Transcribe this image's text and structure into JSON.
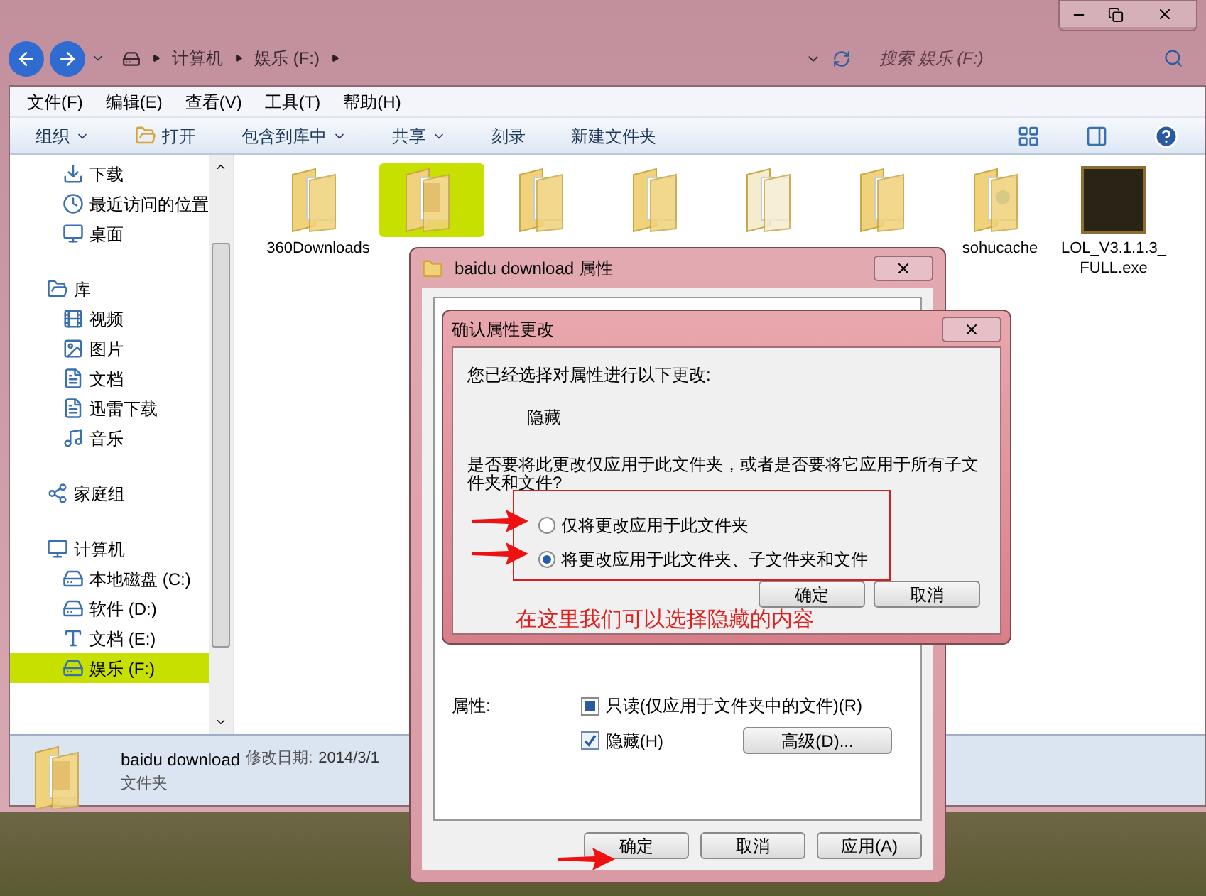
{
  "address_bar": {
    "path": [
      "计算机",
      "娱乐 (F:)"
    ]
  },
  "search": {
    "placeholder": "搜索 娱乐 (F:)"
  },
  "menu": [
    "文件(F)",
    "编辑(E)",
    "查看(V)",
    "工具(T)",
    "帮助(H)"
  ],
  "toolbar": [
    {
      "label": "组织",
      "kind": "dropdown"
    },
    {
      "label": "打开",
      "kind": "open"
    },
    {
      "label": "包含到库中",
      "kind": "dropdown"
    },
    {
      "label": "共享",
      "kind": "dropdown"
    },
    {
      "label": "刻录",
      "kind": "plain"
    },
    {
      "label": "新建文件夹",
      "kind": "plain"
    }
  ],
  "sidebar": {
    "groups": [
      {
        "children": [
          {
            "label": "下载",
            "kind": "download",
            "selected": false
          },
          {
            "label": "最近访问的位置",
            "kind": "recent",
            "selected": false
          },
          {
            "label": "桌面",
            "kind": "desktop",
            "selected": false
          }
        ]
      },
      {
        "label": "库",
        "kind": "library",
        "selected": false,
        "children": [
          {
            "label": "视频",
            "kind": "video",
            "selected": false
          },
          {
            "label": "图片",
            "kind": "picture",
            "selected": false
          },
          {
            "label": "文档",
            "kind": "document",
            "selected": false
          },
          {
            "label": "迅雷下载",
            "kind": "document",
            "selected": false
          },
          {
            "label": "音乐",
            "kind": "music",
            "selected": false
          }
        ]
      },
      {
        "label": "家庭组",
        "kind": "homegroup",
        "selected": false
      },
      {
        "label": "计算机",
        "kind": "computer",
        "selected": false,
        "children": [
          {
            "label": "本地磁盘 (C:)",
            "kind": "drive",
            "selected": false
          },
          {
            "label": "软件 (D:)",
            "kind": "drive",
            "selected": false
          },
          {
            "label": "文档 (E:)",
            "kind": "font",
            "selected": false
          },
          {
            "label": "娱乐 (F:)",
            "kind": "drive",
            "selected": true
          }
        ]
      }
    ]
  },
  "files": [
    {
      "label": "360Downloads",
      "kind": "folder",
      "selected": false
    },
    {
      "kind": "folder-photo",
      "selected": true
    },
    {
      "kind": "folder",
      "selected": false
    },
    {
      "kind": "folder",
      "selected": false
    },
    {
      "kind": "folder-blank",
      "selected": false
    },
    {
      "kind": "folder",
      "selected": false
    },
    {
      "label": "sohucache",
      "kind": "folder-doc",
      "selected": false
    },
    {
      "label": "LOL_V3.1.1.3_FULL.exe",
      "kind": "app",
      "selected": false
    }
  ],
  "details": {
    "name": "baidu download",
    "modified_label": "修改日期:",
    "modified": "2014/3/1",
    "type": "文件夹"
  },
  "properties": {
    "title": "baidu download 属性",
    "attributes_label": "属性:",
    "attributes": [
      {
        "label": "只读(仅应用于文件夹中的文件)(R)",
        "checked": false,
        "indeterminate": true
      },
      {
        "label": "隐藏(H)",
        "checked": true,
        "indeterminate": false
      }
    ],
    "advanced": "高级(D)...",
    "buttons": [
      "确定",
      "取消",
      "应用(A)"
    ]
  },
  "confirm": {
    "title": "确认属性更改",
    "intro": "您已经选择对属性进行以下更改:",
    "change": "隐藏",
    "question": "是否要将此更改仅应用于此文件夹，或者是否要将它应用于所有子文件夹和文件?",
    "options": [
      {
        "label": "仅将更改应用于此文件夹",
        "selected": false
      },
      {
        "label": "将更改应用于此文件夹、子文件夹和文件",
        "selected": true
      }
    ],
    "buttons": [
      "确定",
      "取消"
    ]
  },
  "annotation": {
    "text": "在这里我们可以选择隐藏的内容"
  }
}
